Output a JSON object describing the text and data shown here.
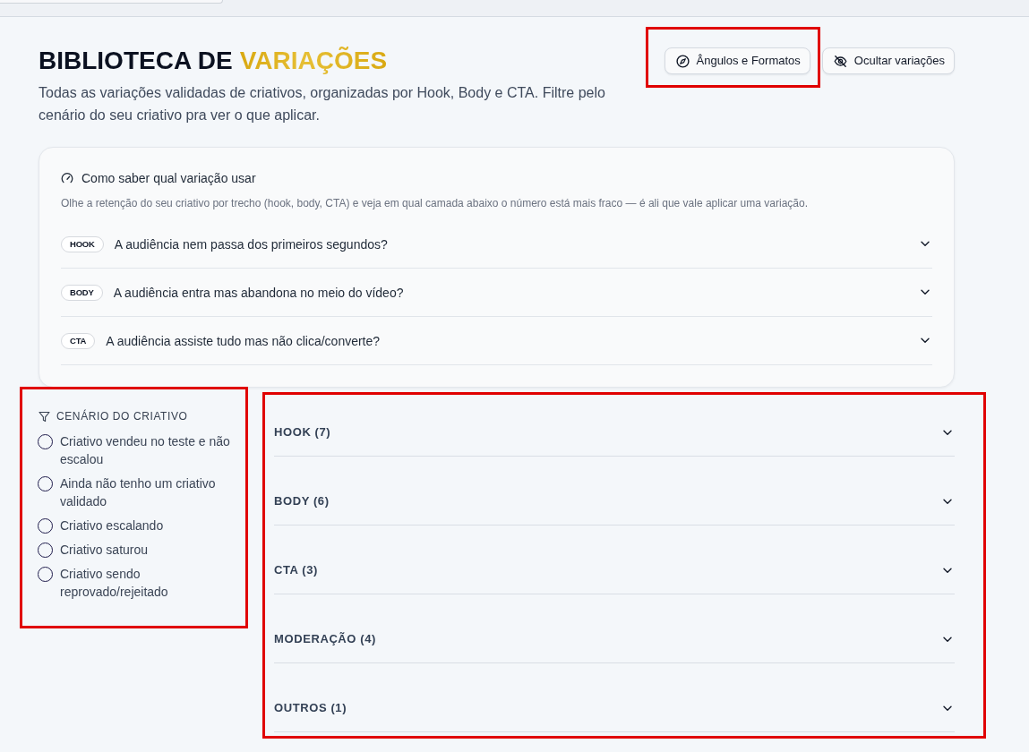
{
  "header": {
    "title": "BIBLIOTECA DE",
    "title_highlight": "VARIAÇÕES",
    "subtitle": "Todas as variações validadas de criativos, organizadas por Hook, Body e CTA. Filtre pelo cenário do seu criativo pra ver o que aplicar.",
    "buttons": [
      {
        "label": "Ângulos e Formatos",
        "highlighted": true
      },
      {
        "label": "Ocultar variações",
        "highlighted": false
      }
    ]
  },
  "guide": {
    "title": "Como saber qual variação usar",
    "description": "Olhe a retenção do seu criativo por trecho (hook, body, CTA) e veja em qual camada abaixo o número está mais fraco — é ali que vale aplicar uma variação.",
    "questions": [
      {
        "tag": "HOOK",
        "text": "A audiência nem passa dos primeiros segundos?",
        "expanded": false
      },
      {
        "tag": "BODY",
        "text": "A audiência entra mas abandona no meio do vídeo?",
        "expanded": false
      },
      {
        "tag": "CTA",
        "text": "A audiência assiste tudo mas não clica/converte?",
        "expanded": false
      }
    ]
  },
  "scenario_filter": {
    "title": "CENÁRIO DO CRIATIVO",
    "highlighted": true,
    "options": [
      {
        "label": "Criativo vendeu no teste e não escalou",
        "selected": false
      },
      {
        "label": "Ainda não tenho um criativo validado",
        "selected": false
      },
      {
        "label": "Criativo escalando",
        "selected": false
      },
      {
        "label": "Criativo saturou",
        "selected": false
      },
      {
        "label": "Criativo sendo reprovado/rejeitado",
        "selected": false
      }
    ]
  },
  "sections": {
    "highlighted": true,
    "items": [
      {
        "label": "HOOK (7)",
        "expanded": false
      },
      {
        "label": "BODY (6)",
        "expanded": false
      },
      {
        "label": "CTA (3)",
        "expanded": false
      },
      {
        "label": "MODERAÇÃO (4)",
        "expanded": false
      },
      {
        "label": "OUTROS (1)",
        "expanded": false
      }
    ]
  }
}
